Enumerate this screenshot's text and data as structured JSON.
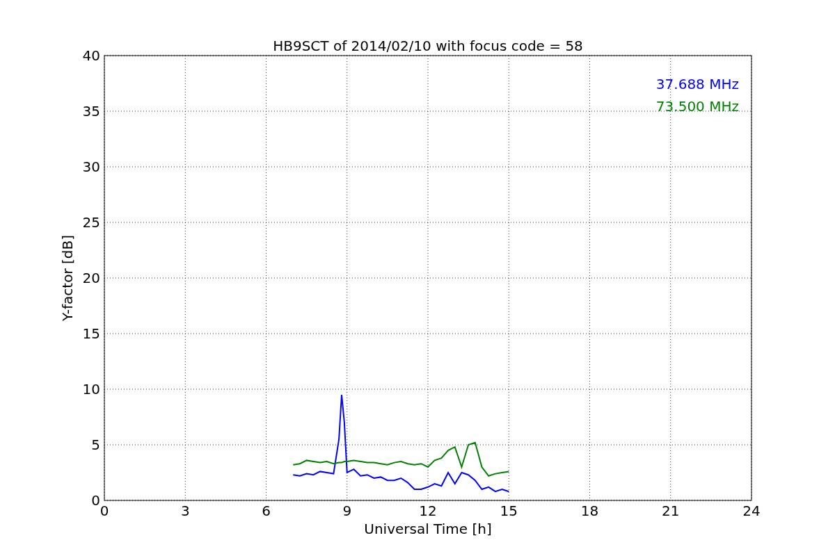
{
  "chart_data": {
    "type": "line",
    "title": "HB9SCT of 2014/02/10 with focus code = 58",
    "xlabel": "Universal Time [h]",
    "ylabel": "Y-factor [dB]",
    "x": [
      7,
      7.25,
      7.5,
      7.75,
      8,
      8.25,
      8.5,
      8.7,
      8.8,
      8.9,
      9,
      9.25,
      9.5,
      9.75,
      10,
      10.25,
      10.5,
      10.75,
      11,
      11.25,
      11.5,
      11.75,
      12,
      12.25,
      12.5,
      12.75,
      13,
      13.25,
      13.5,
      13.75,
      14,
      14.25,
      14.5,
      14.75,
      15
    ],
    "series": [
      {
        "name": "37.688 MHz",
        "color": "#0000ff",
        "values": [
          2.3,
          2.2,
          2.4,
          2.3,
          2.6,
          2.5,
          2.4,
          5.5,
          9.5,
          7,
          2.5,
          2.8,
          2.2,
          2.3,
          2,
          2.1,
          1.8,
          1.8,
          2,
          1.6,
          1,
          1,
          1.2,
          1.5,
          1.3,
          2.5,
          1.5,
          2.5,
          2.3,
          1.8,
          1,
          1.2,
          0.8,
          1,
          0.8
        ]
      },
      {
        "name": "73.500 MHz",
        "color": "#008000",
        "values": [
          3.2,
          3.3,
          3.6,
          3.5,
          3.4,
          3.5,
          3.3,
          3.4,
          3.4,
          3.5,
          3.5,
          3.6,
          3.5,
          3.4,
          3.4,
          3.3,
          3.2,
          3.4,
          3.5,
          3.3,
          3.2,
          3.3,
          3,
          3.6,
          3.8,
          4.5,
          4.8,
          3,
          5,
          5.2,
          3,
          2.2,
          2.4,
          2.5,
          2.6
        ]
      }
    ],
    "xlim": [
      0,
      24
    ],
    "ylim": [
      0,
      40
    ],
    "xticks": [
      0,
      3,
      6,
      9,
      12,
      15,
      18,
      21,
      24
    ],
    "yticks": [
      0,
      5,
      10,
      15,
      20,
      25,
      30,
      35,
      40
    ],
    "grid": true
  }
}
